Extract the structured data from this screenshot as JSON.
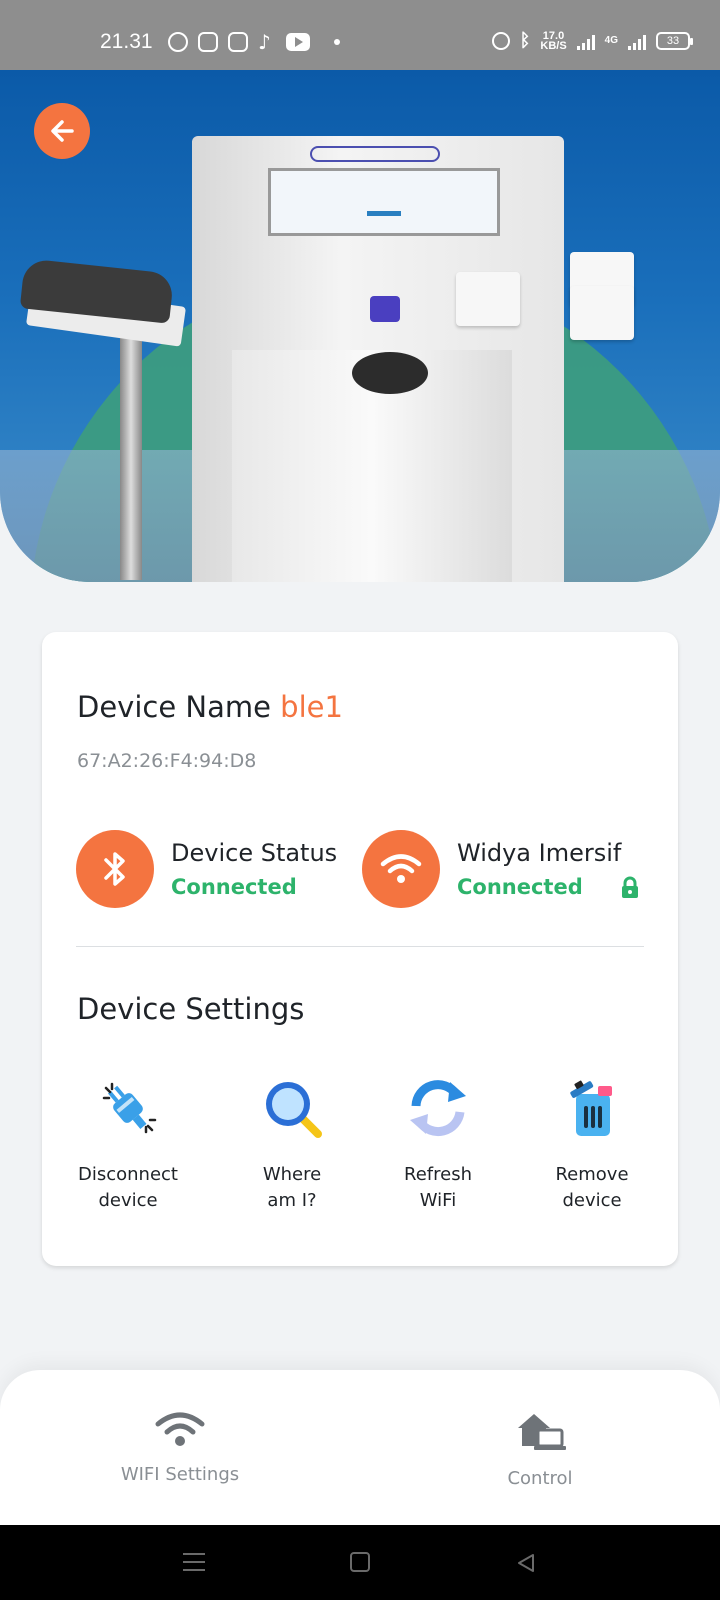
{
  "status_bar": {
    "time": "21.31",
    "speed_value": "17.0",
    "speed_unit": "KB/S",
    "network": "4G",
    "battery": "33"
  },
  "header": {
    "back_icon": "arrow-left-icon"
  },
  "device": {
    "name_label": "Device Name",
    "name_value": "ble1",
    "mac": "67:A2:26:F4:94:D8"
  },
  "status": [
    {
      "icon": "bluetooth-icon",
      "title": "Device Status",
      "value": "Connected"
    },
    {
      "icon": "wifi-icon",
      "title": "Widya Imersif",
      "value": "Connected",
      "secured": true
    }
  ],
  "settings": {
    "title": "Device Settings",
    "items": [
      {
        "icon": "disconnect-plug-icon",
        "line1": "Disconnect",
        "line2": "device"
      },
      {
        "icon": "magnifier-icon",
        "line1": "Where",
        "line2": "am I?"
      },
      {
        "icon": "refresh-icon",
        "line1": "Refresh",
        "line2": "WiFi"
      },
      {
        "icon": "trash-icon",
        "line1": "Remove",
        "line2": "device"
      }
    ]
  },
  "bottom_nav": [
    {
      "icon": "wifi-icon",
      "label": "WIFI Settings"
    },
    {
      "icon": "home-control-icon",
      "label": "Control"
    }
  ],
  "colors": {
    "accent": "#f47440",
    "connected": "#2db36b",
    "muted": "#8a8f94"
  }
}
